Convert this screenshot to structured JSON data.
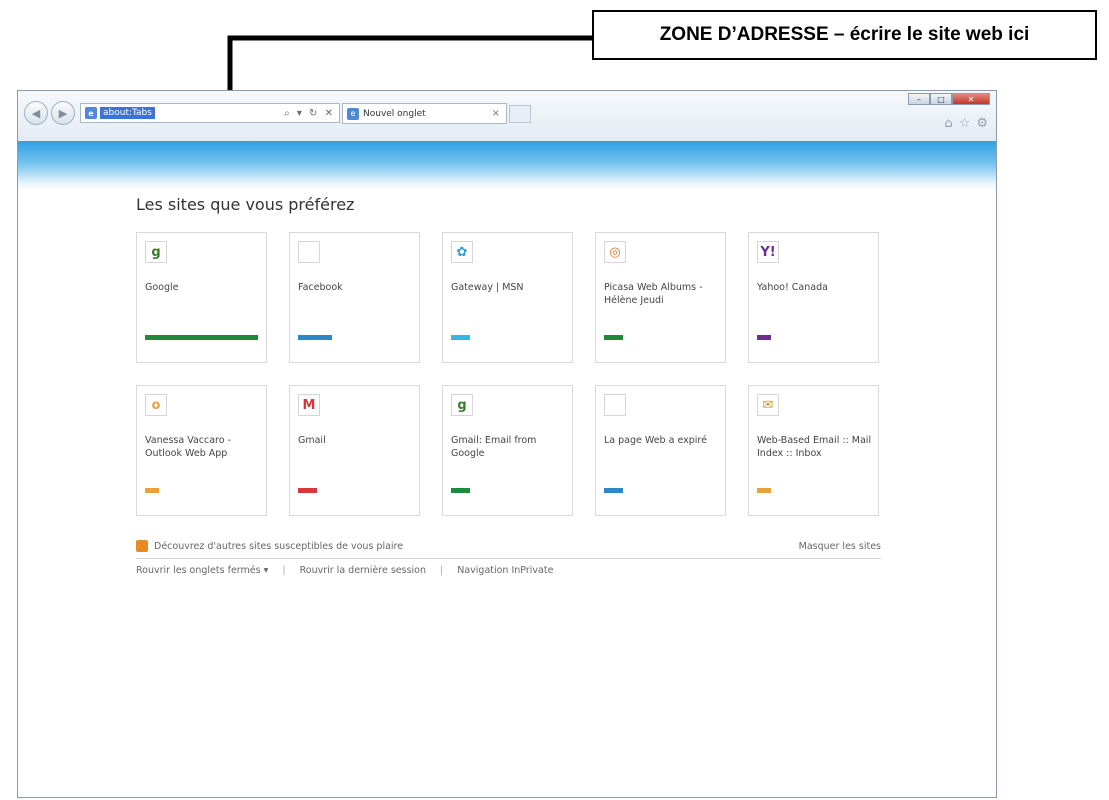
{
  "annotation": {
    "text": "ZONE D’ADRESSE – écrire le site web ici"
  },
  "browser": {
    "address": {
      "value": "about:Tabs",
      "icons": "⌕ ▾ ↻ ✕"
    },
    "tab": {
      "label": "Nouvel onglet",
      "close": "×"
    },
    "window_controls": {
      "minimize": "–",
      "maximize": "□",
      "close": "✕"
    },
    "tool_icons": [
      "home-icon",
      "favorites-star-icon",
      "tools-gear-icon"
    ]
  },
  "page": {
    "heading": "Les sites que vous préférez",
    "tiles": [
      {
        "label": "Google",
        "icon": "google-icon",
        "bar_color": "#1e8a3c",
        "bar_width": 1.0
      },
      {
        "label": "Facebook",
        "icon": "blank-icon",
        "bar_color": "#2a88c8",
        "bar_width": 0.3
      },
      {
        "label": "Gateway | MSN",
        "icon": "msn-butterfly-icon",
        "bar_color": "#36b6e4",
        "bar_width": 0.17
      },
      {
        "label": "Picasa Web Albums - Hélène Jeudi",
        "icon": "picasa-icon",
        "bar_color": "#1e8a3c",
        "bar_width": 0.17
      },
      {
        "label": "Yahoo! Canada",
        "icon": "yahoo-icon",
        "bar_color": "#6b2e8f",
        "bar_width": 0.12
      },
      {
        "label": "Vanessa Vaccaro - Outlook Web App",
        "icon": "outlook-icon",
        "bar_color": "#e8a23a",
        "bar_width": 0.12
      },
      {
        "label": "Gmail",
        "icon": "gmail-icon",
        "bar_color": "#d8383c",
        "bar_width": 0.17
      },
      {
        "label": "Gmail: Email from Google",
        "icon": "google-icon",
        "bar_color": "#1e8a3c",
        "bar_width": 0.17
      },
      {
        "label": "La page Web a expiré",
        "icon": "blank-icon",
        "bar_color": "#2a88c8",
        "bar_width": 0.17
      },
      {
        "label": "Web-Based Email :: Mail Index :: Inbox",
        "icon": "webmail-icon",
        "bar_color": "#e8a23a",
        "bar_width": 0.12
      }
    ],
    "discover_label": "Découvrez d'autres sites susceptibles de vous plaire",
    "hide_sites_label": "Masquer les sites",
    "reopen_tabs_label": "Rouvrir les onglets fermés ▾",
    "reopen_session_label": "Rouvrir la dernière session",
    "inprivate_label": "Navigation InPrivate",
    "separator": "|"
  }
}
